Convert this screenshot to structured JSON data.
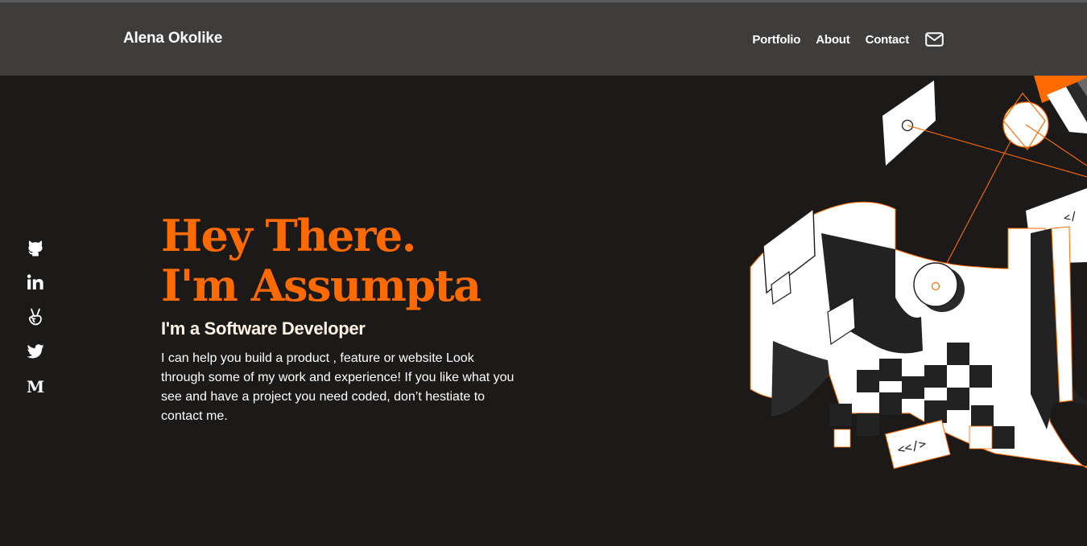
{
  "header": {
    "brand": "Alena Okolike",
    "nav": {
      "portfolio": "Portfolio",
      "about": "About",
      "contact": "Contact"
    },
    "mail_icon": "envelope-icon"
  },
  "social": [
    {
      "icon": "github-icon"
    },
    {
      "icon": "linkedin-icon"
    },
    {
      "icon": "angellist-icon"
    },
    {
      "icon": "twitter-icon"
    },
    {
      "icon": "medium-icon"
    }
  ],
  "hero": {
    "title_line1": "Hey There.",
    "title_line2": "I'm Assumpta",
    "subtitle": "I'm a Software Developer",
    "description": "I can help you build a product , feature or website Look through some of my work and experience! If you like what you see and have a project you need coded, don’t hestiate to contact me."
  },
  "art": {
    "code_tag_top": "</",
    "code_tag_bottom": "<</>"
  },
  "colors": {
    "accent": "#ff6a00",
    "background": "#1c1a19",
    "header": "#3f3d3c",
    "text": "#ffffff"
  }
}
